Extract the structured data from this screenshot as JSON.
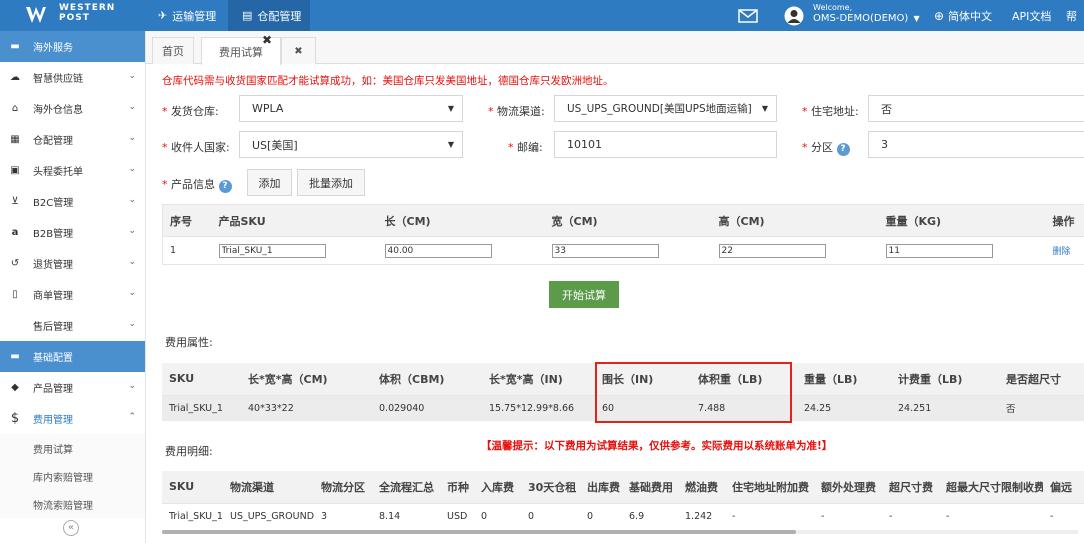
{
  "brand": {
    "line1": "WESTERN",
    "line2": "POST"
  },
  "topnav": {
    "tabs": [
      {
        "label": "运输管理",
        "icon": "send-icon"
      },
      {
        "label": "仓配管理",
        "icon": "clipboard-icon"
      }
    ],
    "welcome": "Welcome,",
    "user": "OMS-DEMO(DEMO)",
    "language": "简体中文",
    "api_doc": "API文档",
    "help": "帮"
  },
  "sidebar": {
    "sections": [
      {
        "label": "海外服务"
      },
      {
        "label": "基础配置"
      }
    ],
    "items_group1": [
      {
        "label": "智慧供应链",
        "icon": "cloud-icon"
      },
      {
        "label": "海外仓信息",
        "icon": "home-icon"
      },
      {
        "label": "仓配管理",
        "icon": "grid-icon"
      },
      {
        "label": "头程委托单",
        "icon": "briefcase-icon"
      },
      {
        "label": "B2C管理",
        "icon": "cart-icon"
      },
      {
        "label": "B2B管理",
        "icon": "amazon-icon"
      },
      {
        "label": "退货管理",
        "icon": "return-icon"
      },
      {
        "label": "商单管理",
        "icon": "document-icon"
      },
      {
        "label": "售后管理",
        "icon": ""
      }
    ],
    "items_group2": [
      {
        "label": "产品管理",
        "icon": "tag-icon"
      },
      {
        "label": "费用管理",
        "icon": "dollar-icon"
      }
    ],
    "subitems": [
      "费用试算",
      "库内索赔管理",
      "物流索赔管理"
    ],
    "collapse_symbol": "«"
  },
  "page_tabs": [
    {
      "label": "首页"
    },
    {
      "label": "费用试算"
    },
    {
      "label": "✖"
    }
  ],
  "warning": "仓库代码需与收货国家匹配才能试算成功，如：美国仓库只发美国地址，德国仓库只发欧洲地址。",
  "form": {
    "warehouse_label": "发货仓库:",
    "warehouse_value": "WPLA",
    "channel_label": "物流渠道:",
    "channel_value": "US_UPS_GROUND[美国UPS地面运输]",
    "residential_label": "住宅地址:",
    "residential_value": "否",
    "country_label": "收件人国家:",
    "country_value": "US[美国]",
    "zip_label": "邮编:",
    "zip_value": "10101",
    "zone_label": "分区",
    "zone_value": "3",
    "product_label": "产品信息",
    "add_button": "添加",
    "bulk_add_button": "批量添加",
    "required_mark": "*",
    "help_mark": "?"
  },
  "product_table": {
    "headers": [
      "序号",
      "产品SKU",
      "长（CM)",
      "宽（CM)",
      "高（CM)",
      "重量（KG)",
      "操作"
    ],
    "rows": [
      {
        "no": "1",
        "sku": "Trial_SKU_1",
        "length": "40.00",
        "width": "33",
        "height": "22",
        "weight": "11",
        "action": "删除"
      }
    ]
  },
  "calc_button": "开始试算",
  "attributes": {
    "title": "费用属性:",
    "headers": [
      "SKU",
      "长*宽*高（CM)",
      "体积（CBM)",
      "长*宽*高（IN)",
      "围长（IN)",
      "体积重（LB)",
      "重量（LB)",
      "计费重（LB)",
      "是否超尺寸"
    ],
    "rows": [
      [
        "Trial_SKU_1",
        "40*33*22",
        "0.029040",
        "15.75*12.99*8.66",
        "60",
        "7.488",
        "24.25",
        "24.251",
        "否"
      ]
    ]
  },
  "details": {
    "title": "费用明细:",
    "tip": "【温馨提示：以下费用为试算结果，仅供参考。实际费用以系统账单为准!】",
    "headers": [
      "SKU",
      "物流渠道",
      "物流分区",
      "全流程汇总",
      "币种",
      "入库费",
      "30天仓租",
      "出库费",
      "基础费用",
      "燃油费",
      "住宅地址附加费",
      "额外处理费",
      "超尺寸费",
      "超最大尺寸限制收费",
      "偏远"
    ],
    "rows": [
      [
        "Trial_SKU_1",
        "US_UPS_GROUND",
        "3",
        "8.14",
        "USD",
        "0",
        "0",
        "0",
        "6.9",
        "1.242",
        "-",
        "-",
        "-",
        "-",
        "-"
      ]
    ]
  },
  "colors": {
    "topbar": "#2f7bc1",
    "sidebar_section": "#4a90cf",
    "warning": "#e8100d",
    "calc_button": "#5b9b4a",
    "highlight_box": "#e0241b"
  }
}
